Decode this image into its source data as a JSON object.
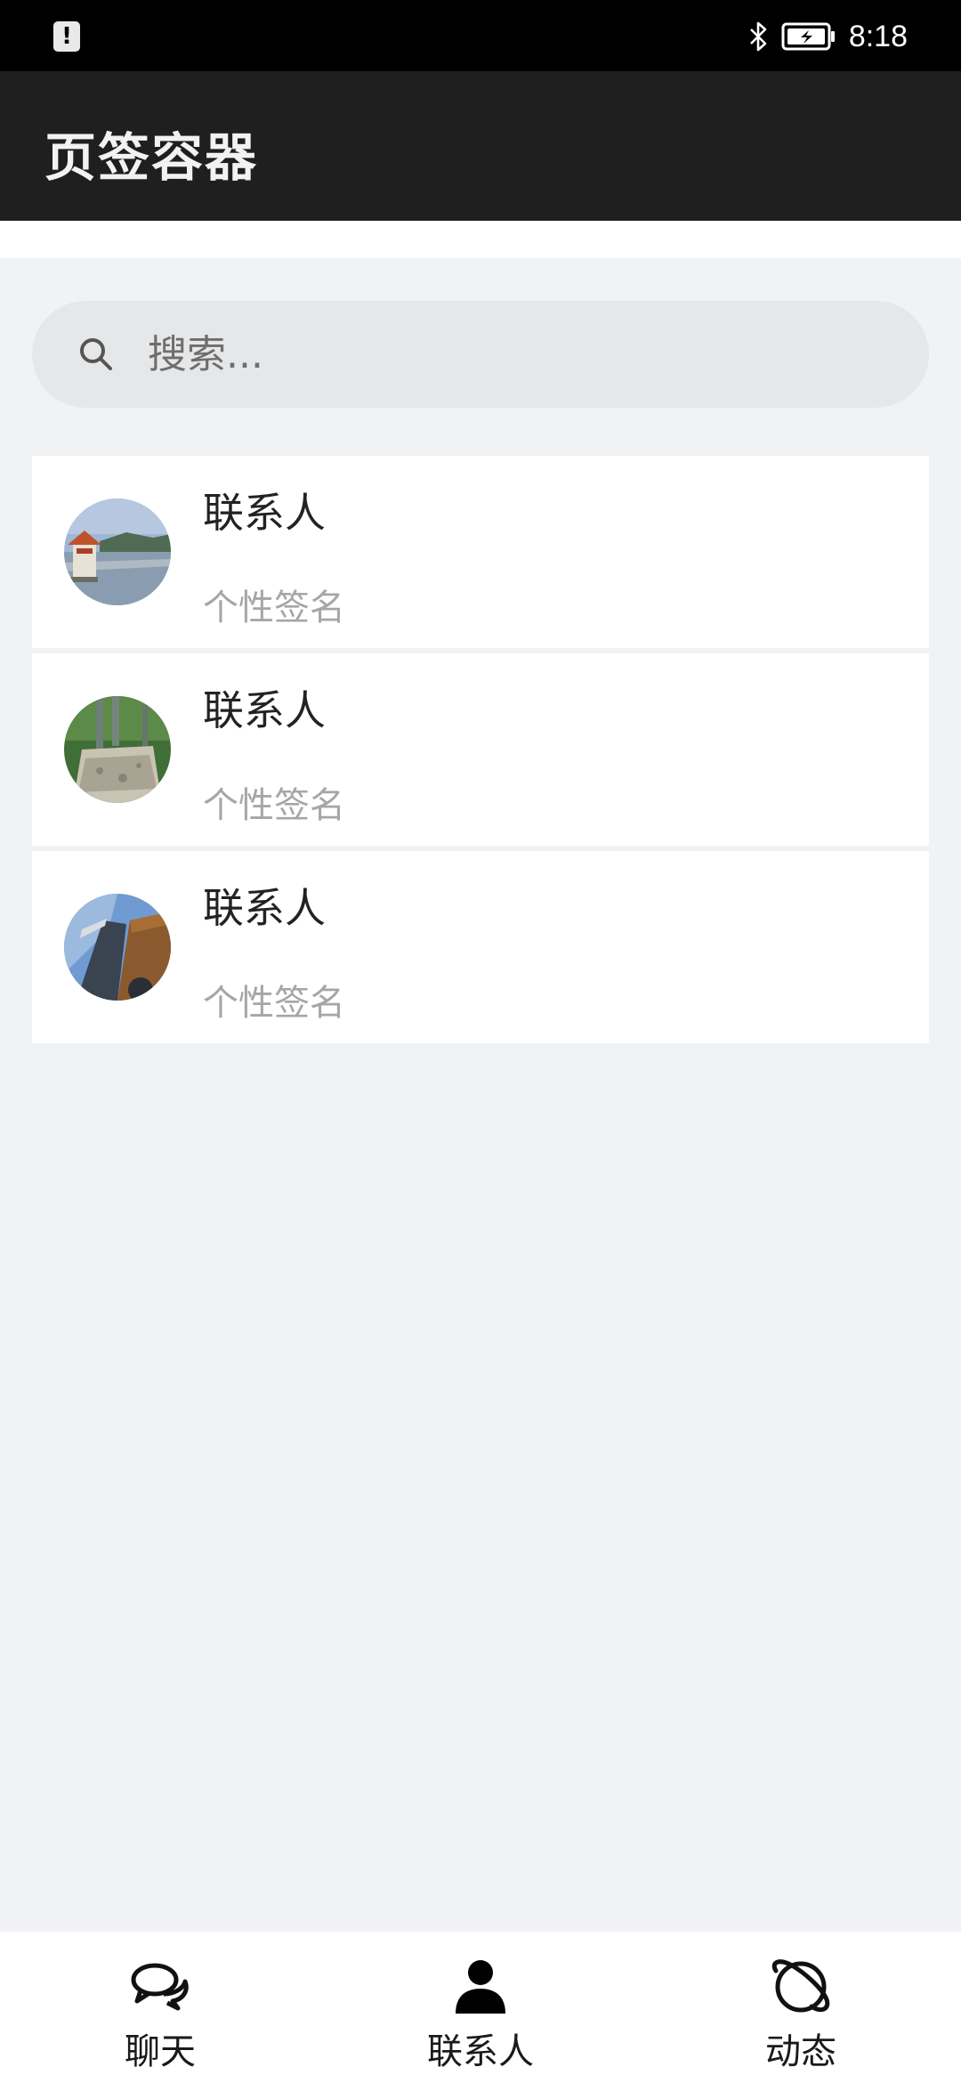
{
  "status_bar": {
    "alert_icon": "alert-icon",
    "bluetooth_icon": "bluetooth-icon",
    "battery_icon": "battery-charging-icon",
    "time": "8:18"
  },
  "app_bar": {
    "title": "页签容器"
  },
  "search": {
    "placeholder": "搜索...",
    "icon": "search-icon"
  },
  "contacts": [
    {
      "name": "联系人",
      "signature": "个性签名",
      "avatar": "pagoda-lake-photo"
    },
    {
      "name": "联系人",
      "signature": "个性签名",
      "avatar": "garden-stone-photo"
    },
    {
      "name": "联系人",
      "signature": "个性签名",
      "avatar": "building-sky-photo"
    }
  ],
  "bottom_nav": {
    "tabs": [
      {
        "label": "聊天",
        "icon": "chat-bubbles-icon"
      },
      {
        "label": "联系人",
        "icon": "person-icon",
        "active": true
      },
      {
        "label": "动态",
        "icon": "planet-icon"
      }
    ]
  },
  "colors": {
    "app_bar": "#1f1f1f",
    "background": "#f1f2f4",
    "search_bg": "#e6e7e9",
    "signature_text": "#a6a6a6"
  }
}
